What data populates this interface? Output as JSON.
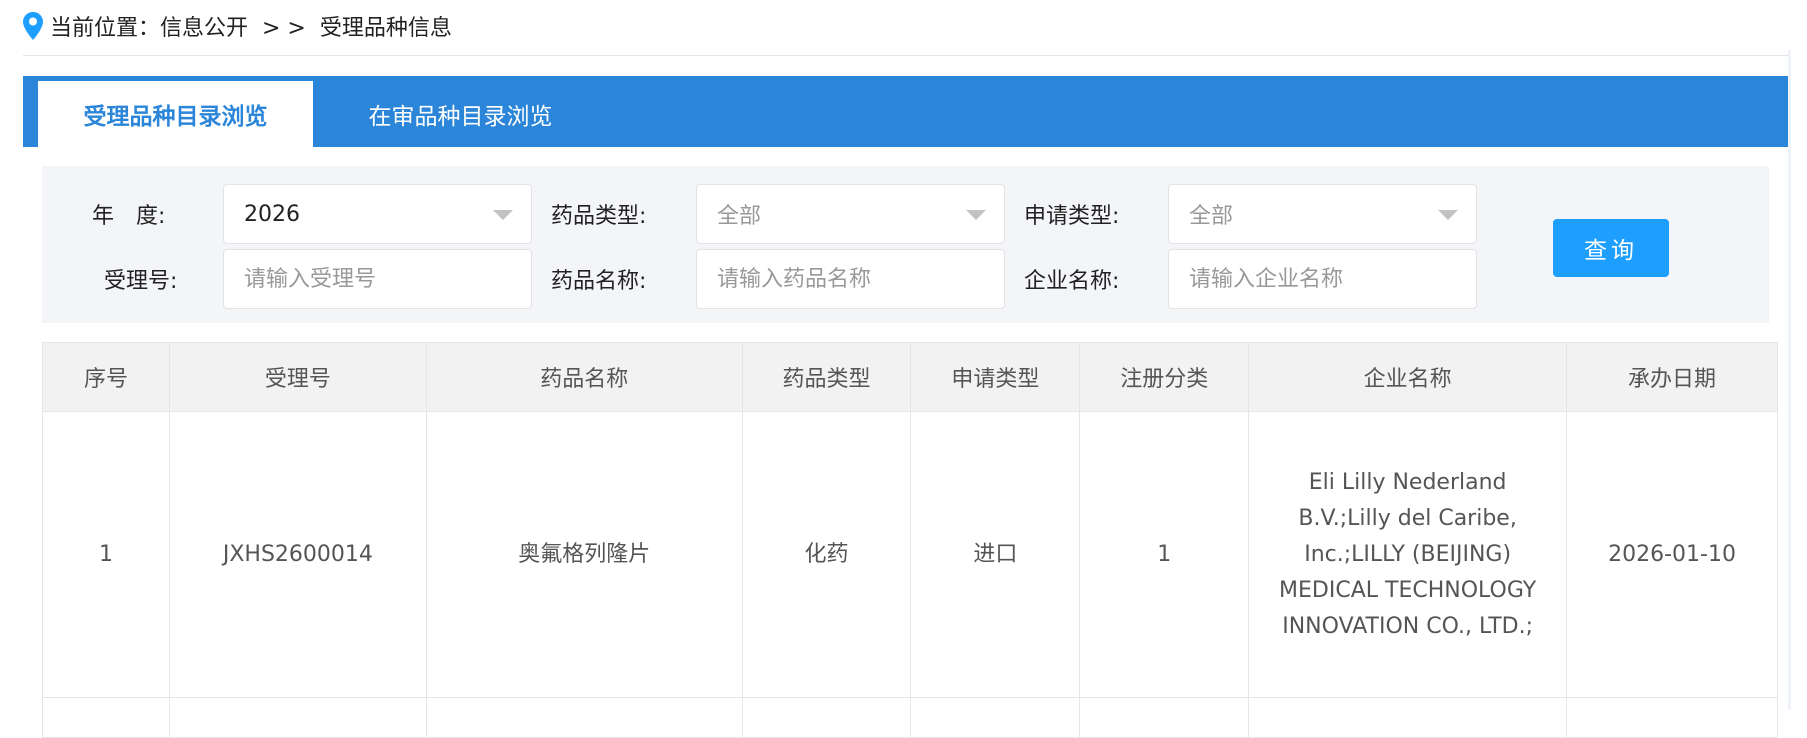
{
  "breadcrumb": {
    "prefix": "当前位置：",
    "path": "信息公开  > >  受理品种信息"
  },
  "tabs": [
    {
      "label": "受理品种目录浏览",
      "active": true
    },
    {
      "label": "在审品种目录浏览",
      "active": false
    }
  ],
  "filters": {
    "year": {
      "label": "年　度:",
      "value": "2026"
    },
    "drug_type": {
      "label": "药品类型:",
      "value": "全部"
    },
    "apply_type": {
      "label": "申请类型:",
      "value": "全部"
    },
    "accept_no": {
      "label": "受理号:",
      "placeholder": "请输入受理号"
    },
    "drug_name": {
      "label": "药品名称:",
      "placeholder": "请输入药品名称"
    },
    "company": {
      "label": "企业名称:",
      "placeholder": "请输入企业名称"
    },
    "search_label": "查询"
  },
  "table": {
    "headers": [
      "序号",
      "受理号",
      "药品名称",
      "药品类型",
      "申请类型",
      "注册分类",
      "企业名称",
      "承办日期"
    ],
    "rows": [
      [
        "1",
        "JXHS2600014",
        "奥氟格列隆片",
        "化药",
        "进口",
        "1",
        "Eli Lilly Nederland B.V.;Lilly del Caribe, Inc.;LILLY (BEIJING) MEDICAL TECHNOLOGY INNOVATION CO., LTD.;",
        "2026-01-10"
      ]
    ]
  },
  "colors": {
    "brand": "#2b86d9",
    "button": "#1e9fff"
  }
}
